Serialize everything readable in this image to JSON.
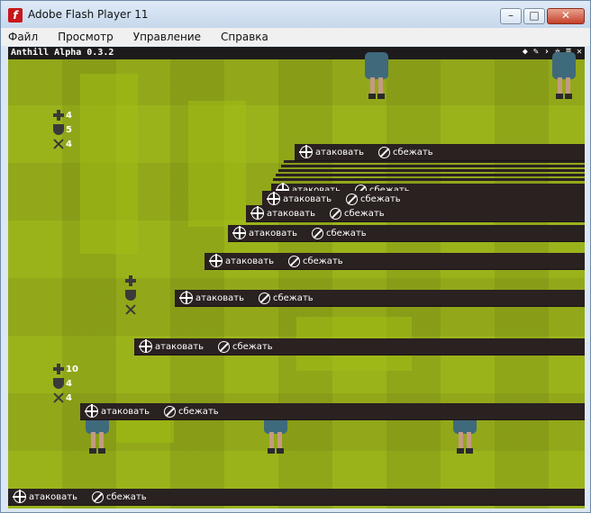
{
  "window": {
    "title": "Adobe Flash Player 11",
    "controls": {
      "minimize": "–",
      "maximize": "□",
      "close": "✕"
    }
  },
  "menu": [
    "Файл",
    "Просмотр",
    "Управление",
    "Справка"
  ],
  "game": {
    "title": "Anthill Alpha 0.3.2",
    "toolbar_icons": [
      "sound-icon",
      "wand-icon",
      "console-icon",
      "gear-icon",
      "grid-icon",
      "close-icon"
    ]
  },
  "actions": {
    "attack": "атаковать",
    "flee": "сбежать"
  },
  "unit_stats": [
    {
      "hp": "4",
      "armor": "5",
      "attack": "4"
    },
    {
      "hp": "10",
      "armor": "4",
      "attack": "4"
    }
  ],
  "colors": {
    "grass": "#9bb31b",
    "bar": "#2a2121",
    "creature": "#3e6a7c"
  }
}
